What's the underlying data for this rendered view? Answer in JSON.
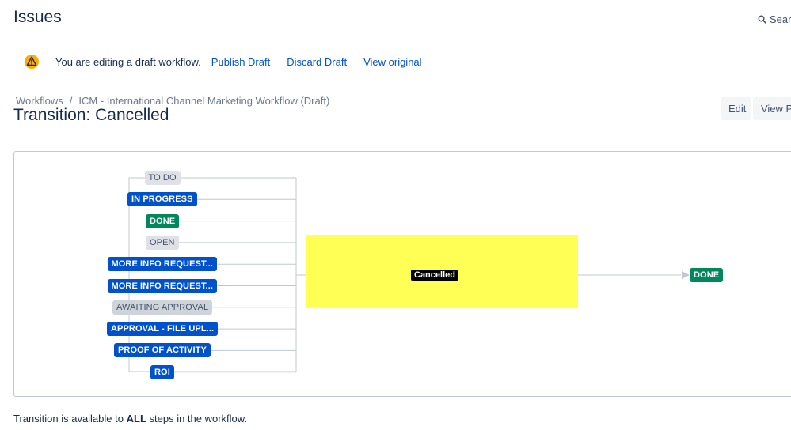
{
  "header": {
    "title": "Issues",
    "search_label": "Search"
  },
  "draft_banner": {
    "message": "You are editing a draft workflow.",
    "publish": "Publish Draft",
    "discard": "Discard Draft",
    "view_original": "View original"
  },
  "breadcrumb": {
    "root": "Workflows",
    "separator": "/",
    "current": "ICM - International Channel Marketing Workflow (Draft)"
  },
  "transition": {
    "title": "Transition: Cancelled",
    "name": "Cancelled"
  },
  "actions": {
    "edit": "Edit",
    "view": "View Properties"
  },
  "diagram": {
    "source_statuses": [
      {
        "label": "TO DO",
        "category": "todo"
      },
      {
        "label": "IN PROGRESS",
        "category": "inprogress"
      },
      {
        "label": "DONE",
        "category": "done"
      },
      {
        "label": "OPEN",
        "category": "todo"
      },
      {
        "label": "MORE INFO REQUEST...",
        "category": "inprogress"
      },
      {
        "label": "MORE INFO REQUEST...",
        "category": "inprogress"
      },
      {
        "label": "AWAITING APPROVAL",
        "category": "todo"
      },
      {
        "label": "APPROVAL - FILE UPL...",
        "category": "inprogress"
      },
      {
        "label": "PROOF OF ACTIVITY",
        "category": "inprogress"
      },
      {
        "label": "ROI",
        "category": "inprogress"
      }
    ],
    "target_status": {
      "label": "DONE",
      "category": "done"
    },
    "colors": {
      "todo": "#dfe1e6",
      "inprogress": "#0052cc",
      "done": "#00875a",
      "highlight": "#ffff55"
    }
  },
  "footer": {
    "prefix": "Transition is available to",
    "emphasis": "ALL",
    "suffix": "steps in the workflow."
  }
}
